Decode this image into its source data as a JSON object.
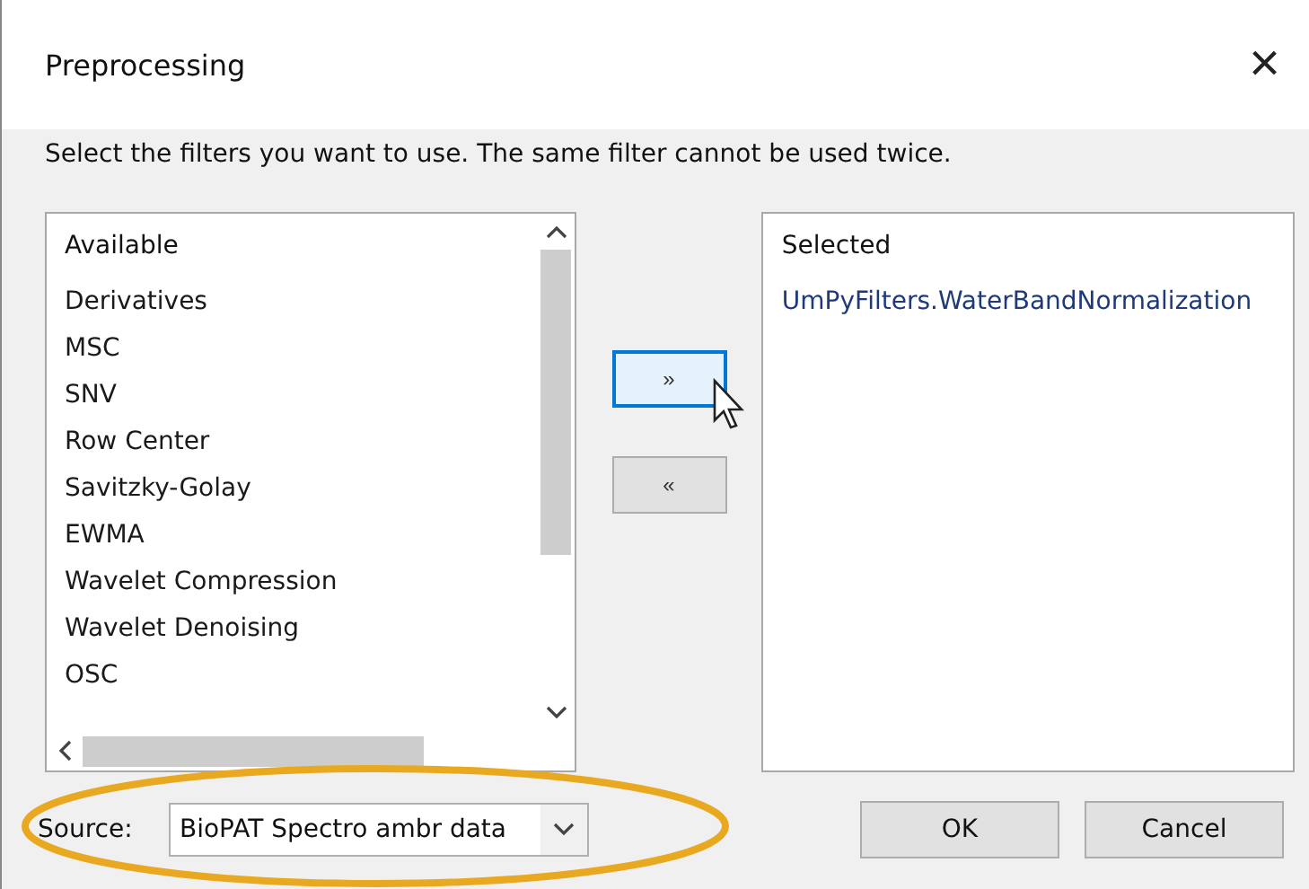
{
  "window": {
    "title": "Preprocessing",
    "close": "×"
  },
  "instruction": "Select the filters you want to use. The same filter cannot be used twice.",
  "available": {
    "header": "Available",
    "items": [
      {
        "label": "Derivatives",
        "selected": false
      },
      {
        "label": "MSC",
        "selected": false
      },
      {
        "label": "SNV",
        "selected": false
      },
      {
        "label": "Row Center",
        "selected": false
      },
      {
        "label": "Savitzky-Golay",
        "selected": false
      },
      {
        "label": "EWMA",
        "selected": false
      },
      {
        "label": "Wavelet Compression",
        "selected": false
      },
      {
        "label": "Wavelet Denoising",
        "selected": false
      },
      {
        "label": "OSC",
        "selected": false
      }
    ]
  },
  "move_buttons": [
    {
      "label": "»",
      "hovered": true
    },
    {
      "label": "«",
      "hovered": false
    }
  ],
  "selected_list": {
    "header": "Selected",
    "items": [
      {
        "label": "UmPyFilters.WaterBandNormalization",
        "selected": false
      }
    ]
  },
  "source": {
    "label": "Source:",
    "value": "BioPAT Spectro ambr data"
  },
  "buttons": [
    "OK",
    "Cancel"
  ]
}
